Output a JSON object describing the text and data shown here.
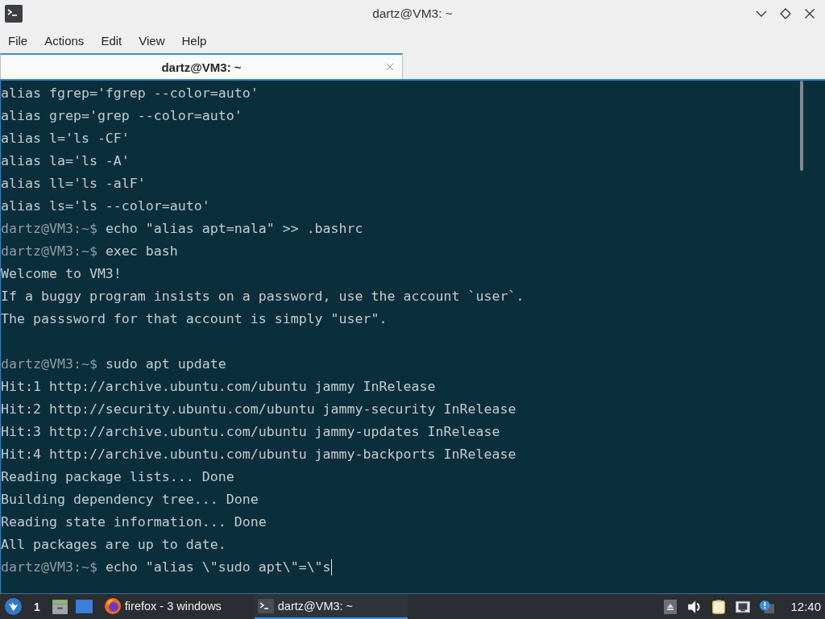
{
  "window": {
    "title": "dartz@VM3: ~"
  },
  "menu": [
    "File",
    "Actions",
    "Edit",
    "View",
    "Help"
  ],
  "tabs": [
    {
      "label": "dartz@VM3: ~",
      "selected": true
    }
  ],
  "terminal": {
    "cursor": true,
    "lines": [
      {
        "kind": "output",
        "text": "alias fgrep='fgrep --color=auto'"
      },
      {
        "kind": "output",
        "text": "alias grep='grep --color=auto'"
      },
      {
        "kind": "output",
        "text": "alias l='ls -CF'"
      },
      {
        "kind": "output",
        "text": "alias la='ls -A'"
      },
      {
        "kind": "output",
        "text": "alias ll='ls -alF'"
      },
      {
        "kind": "output",
        "text": "alias ls='ls --color=auto'"
      },
      {
        "kind": "prompt",
        "prompt": "dartz@VM3:~$",
        "command": "echo \"alias apt=nala\" >> .bashrc"
      },
      {
        "kind": "prompt",
        "prompt": "dartz@VM3:~$",
        "command": "exec bash"
      },
      {
        "kind": "output",
        "text": "Welcome to VM3!"
      },
      {
        "kind": "output",
        "text": "If a buggy program insists on a password, use the account `user`."
      },
      {
        "kind": "output",
        "text": "The passsword for that account is simply \"user\"."
      },
      {
        "kind": "blank"
      },
      {
        "kind": "prompt",
        "prompt": "dartz@VM3:~$",
        "command": "sudo apt update"
      },
      {
        "kind": "output",
        "text": "Hit:1 http://archive.ubuntu.com/ubuntu jammy InRelease"
      },
      {
        "kind": "output",
        "text": "Hit:2 http://security.ubuntu.com/ubuntu jammy-security InRelease"
      },
      {
        "kind": "output",
        "text": "Hit:3 http://archive.ubuntu.com/ubuntu jammy-updates InRelease"
      },
      {
        "kind": "output",
        "text": "Hit:4 http://archive.ubuntu.com/ubuntu jammy-backports InRelease"
      },
      {
        "kind": "output",
        "text": "Reading package lists... Done"
      },
      {
        "kind": "output",
        "text": "Building dependency tree... Done"
      },
      {
        "kind": "output",
        "text": "Reading state information... Done"
      },
      {
        "kind": "output",
        "text": "All packages are up to date."
      },
      {
        "kind": "prompt",
        "prompt": "dartz@VM3:~$",
        "command": "echo \"alias \\\"sudo apt\\\"=\\\"s"
      }
    ]
  },
  "taskbar": {
    "workspace": "1",
    "tasks": [
      {
        "kind": "browser",
        "label": "firefox - 3 windows",
        "selected": false
      },
      {
        "kind": "terminal",
        "label": "dartz@VM3: ~",
        "selected": true
      }
    ],
    "clock": "12:40"
  }
}
